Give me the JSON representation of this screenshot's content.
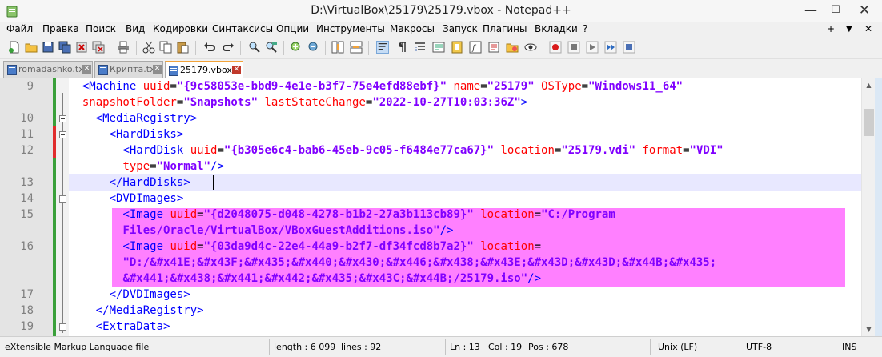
{
  "window": {
    "title": "D:\\VirtualBox\\25179\\25179.vbox - Notepad++",
    "minimize_glyph": "—",
    "maximize_glyph": "☐",
    "close_glyph": "✕"
  },
  "menu": {
    "items": [
      "Файл",
      "Правка",
      "Поиск",
      "Вид",
      "Кодировки",
      "Синтаксисы",
      "Опции",
      "Инструменты",
      "Макросы",
      "Запуск",
      "Плагины",
      "Вкладки",
      "?"
    ],
    "right_plus": "+",
    "right_down": "▼",
    "right_close": "✕"
  },
  "toolbar": {
    "icons": [
      "new-file-icon",
      "open-file-icon",
      "save-icon",
      "save-all-icon",
      "close-icon",
      "close-all-icon",
      "print-icon",
      "cut-icon",
      "copy-icon",
      "paste-icon",
      "undo-icon",
      "redo-icon",
      "find-icon",
      "replace-icon",
      "zoom-in-icon",
      "zoom-out-icon",
      "sync-vertical-icon",
      "sync-horizontal-icon",
      "word-wrap-icon",
      "show-all-chars-icon",
      "indent-guide-icon",
      "udl-icon",
      "doc-map-icon",
      "function-list-icon",
      "folder-workspace-icon",
      "monitor-icon",
      "record-macro-icon",
      "stop-macro-icon",
      "play-macro-icon",
      "run-macro-multiple-icon",
      "save-macro-icon"
    ],
    "colors": {
      "accent_orange": "#f2a33a",
      "macro_red": "#d91a1a"
    }
  },
  "tabs": [
    {
      "label": "romadashko.txt",
      "active": false
    },
    {
      "label": "Крипта.txt",
      "active": false
    },
    {
      "label": "25179.vbox",
      "active": true
    }
  ],
  "editor": {
    "line_numbers": [
      "9",
      "",
      "10",
      "11",
      "12",
      "",
      "13",
      "14",
      "15",
      "",
      "16",
      "",
      "",
      "17",
      "18",
      "19"
    ],
    "caret_line": 13,
    "highlight_color": "#ff80ff",
    "lines": [
      [
        {
          "t": "  ",
          "c": "txt"
        },
        {
          "t": "<Machine",
          "c": "tag"
        },
        {
          "t": " uuid",
          "c": "attr"
        },
        {
          "t": "=",
          "c": "txt"
        },
        {
          "t": "\"{9c58053e-bbd9-4e1e-b3f7-75e4efd88ebf}\"",
          "c": "val"
        },
        {
          "t": " name",
          "c": "attr"
        },
        {
          "t": "=",
          "c": "txt"
        },
        {
          "t": "\"25179\"",
          "c": "val"
        },
        {
          "t": " OSType",
          "c": "attr"
        },
        {
          "t": "=",
          "c": "txt"
        },
        {
          "t": "\"Windows11_64\"",
          "c": "val"
        }
      ],
      [
        {
          "t": "  ",
          "c": "txt"
        },
        {
          "t": "snapshotFolder",
          "c": "attr"
        },
        {
          "t": "=",
          "c": "txt"
        },
        {
          "t": "\"Snapshots\"",
          "c": "val"
        },
        {
          "t": " lastStateChange",
          "c": "attr"
        },
        {
          "t": "=",
          "c": "txt"
        },
        {
          "t": "\"2022-10-27T10:03:36Z\"",
          "c": "val"
        },
        {
          "t": ">",
          "c": "tag"
        }
      ],
      [
        {
          "t": "    ",
          "c": "txt"
        },
        {
          "t": "<MediaRegistry>",
          "c": "tag"
        }
      ],
      [
        {
          "t": "      ",
          "c": "txt"
        },
        {
          "t": "<HardDisks>",
          "c": "tag"
        }
      ],
      [
        {
          "t": "        ",
          "c": "txt"
        },
        {
          "t": "<HardDisk",
          "c": "tag"
        },
        {
          "t": " uuid",
          "c": "attr"
        },
        {
          "t": "=",
          "c": "txt"
        },
        {
          "t": "\"{b305e6c4-bab6-45eb-9c05-f6484e77ca67}\"",
          "c": "val"
        },
        {
          "t": " location",
          "c": "attr"
        },
        {
          "t": "=",
          "c": "txt"
        },
        {
          "t": "\"25179.vdi\"",
          "c": "val"
        },
        {
          "t": " format",
          "c": "attr"
        },
        {
          "t": "=",
          "c": "txt"
        },
        {
          "t": "\"VDI\"",
          "c": "val"
        }
      ],
      [
        {
          "t": "        ",
          "c": "txt"
        },
        {
          "t": "type",
          "c": "attr"
        },
        {
          "t": "=",
          "c": "txt"
        },
        {
          "t": "\"Normal\"",
          "c": "val"
        },
        {
          "t": "/>",
          "c": "tag"
        }
      ],
      [
        {
          "t": "      ",
          "c": "txt"
        },
        {
          "t": "</HardDisks>",
          "c": "tag"
        }
      ],
      [
        {
          "t": "      ",
          "c": "txt"
        },
        {
          "t": "<DVDImages>",
          "c": "tag"
        }
      ],
      [
        {
          "t": "        ",
          "c": "txt"
        },
        {
          "t": "<Image",
          "c": "tag"
        },
        {
          "t": " uuid",
          "c": "attr"
        },
        {
          "t": "=",
          "c": "txt"
        },
        {
          "t": "\"{d2048075-d048-4278-b1b2-27a3b113cb89}\"",
          "c": "val"
        },
        {
          "t": " location",
          "c": "attr"
        },
        {
          "t": "=",
          "c": "txt"
        },
        {
          "t": "\"C:/Program",
          "c": "val"
        }
      ],
      [
        {
          "t": "        ",
          "c": "txt"
        },
        {
          "t": "Files/Oracle/VirtualBox/VBoxGuestAdditions.iso\"",
          "c": "val"
        },
        {
          "t": "/>",
          "c": "tag"
        }
      ],
      [
        {
          "t": "        ",
          "c": "txt"
        },
        {
          "t": "<Image",
          "c": "tag"
        },
        {
          "t": " uuid",
          "c": "attr"
        },
        {
          "t": "=",
          "c": "txt"
        },
        {
          "t": "\"{03da9d4c-22e4-44a9-b2f7-df34fcd8b7a2}\"",
          "c": "val"
        },
        {
          "t": " location",
          "c": "attr"
        },
        {
          "t": "=",
          "c": "txt"
        }
      ],
      [
        {
          "t": "        ",
          "c": "txt"
        },
        {
          "t": "\"D:/&#x41E;&#x43F;&#x435;&#x440;&#x430;&#x446;&#x438;&#x43E;&#x43D;&#x43D;&#x44B;&#x435;",
          "c": "val"
        }
      ],
      [
        {
          "t": "        ",
          "c": "txt"
        },
        {
          "t": "&#x441;&#x438;&#x441;&#x442;&#x435;&#x43C;&#x44B;/25179.iso\"",
          "c": "val"
        },
        {
          "t": "/>",
          "c": "tag"
        }
      ],
      [
        {
          "t": "      ",
          "c": "txt"
        },
        {
          "t": "</DVDImages>",
          "c": "tag"
        }
      ],
      [
        {
          "t": "    ",
          "c": "txt"
        },
        {
          "t": "</MediaRegistry>",
          "c": "tag"
        }
      ],
      [
        {
          "t": "    ",
          "c": "txt"
        },
        {
          "t": "<ExtraData>",
          "c": "tag"
        }
      ]
    ]
  },
  "statusbar": {
    "file_type": "eXtensible Markup Language file",
    "length": "length : 6 099",
    "lines": "lines : 92",
    "ln": "Ln : 13",
    "col": "Col : 19",
    "pos": "Pos : 678",
    "eol": "Unix (LF)",
    "encoding": "UTF-8",
    "mode": "INS"
  }
}
